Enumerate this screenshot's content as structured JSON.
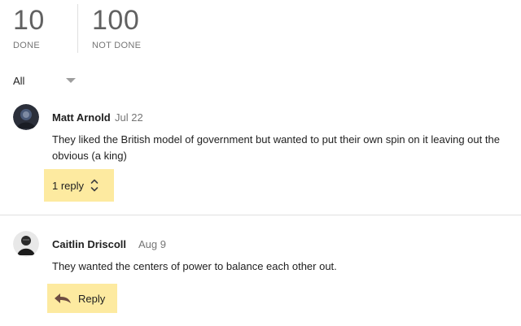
{
  "stats": {
    "done": {
      "count": "10",
      "label": "DONE"
    },
    "not_done": {
      "count": "100",
      "label": "NOT DONE"
    }
  },
  "filter": {
    "value": "All",
    "icon": "chevron-down-icon"
  },
  "comments": [
    {
      "author": "Matt Arnold",
      "date": "Jul 22",
      "text": "They liked the British model of government but wanted to put their own spin on it leaving out the obvious (a king)",
      "replies_label": "1 reply",
      "replies_icon": "expand-collapse-icon"
    },
    {
      "author": "Caitlin Driscoll",
      "date": "Aug 9",
      "text": "They wanted the centers of power to balance each other out.",
      "reply_label": "Reply",
      "reply_icon": "reply-arrow-icon"
    }
  ],
  "colors": {
    "highlight": "#fdeaa0",
    "divider": "#e0e0e0",
    "muted_text": "#757575"
  }
}
